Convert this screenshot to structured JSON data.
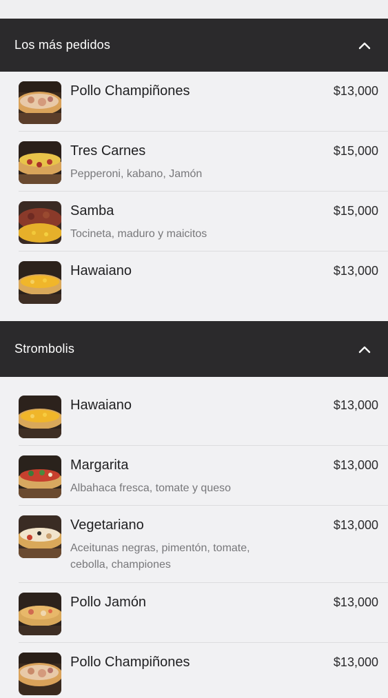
{
  "sections": [
    {
      "title": "Los más pedidos",
      "items": [
        {
          "name": "Pollo Champiñones",
          "price": "$13,000",
          "description": ""
        },
        {
          "name": "Tres Carnes",
          "price": "$15,000",
          "description": "Pepperoni, kabano, Jamón"
        },
        {
          "name": "Samba",
          "price": "$15,000",
          "description": "Tocineta, maduro y maicitos"
        },
        {
          "name": "Hawaiano",
          "price": "$13,000",
          "description": ""
        }
      ]
    },
    {
      "title": "Strombolis",
      "items": [
        {
          "name": "Hawaiano",
          "price": "$13,000",
          "description": ""
        },
        {
          "name": "Margarita",
          "price": "$13,000",
          "description": "Albahaca fresca, tomate y queso"
        },
        {
          "name": "Vegetariano",
          "price": "$13,000",
          "description": "Aceitunas negras, pimentón, tomate, cebolla, championes"
        },
        {
          "name": "Pollo Jamón",
          "price": "$13,000",
          "description": ""
        },
        {
          "name": "Pollo Champiñones",
          "price": "$13,000",
          "description": ""
        }
      ]
    }
  ],
  "colors": {
    "header_bg": "#2b2a2c",
    "page_bg": "#efeff1",
    "price_text": "#2a2a2c",
    "description_text": "#77777a"
  }
}
